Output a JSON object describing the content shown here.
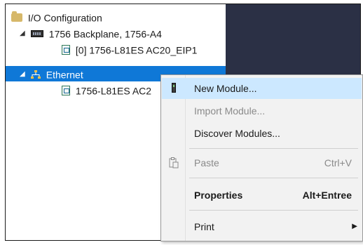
{
  "tree": {
    "root": {
      "label": "I/O Configuration",
      "icon": "folder-icon"
    },
    "backplane": {
      "label": "1756 Backplane, 1756-A4",
      "icon": "backplane-icon",
      "expander": "◢"
    },
    "controller": {
      "label": "[0] 1756-L81ES AC20_EIP1",
      "icon": "module-icon"
    },
    "ethernet": {
      "label": "Ethernet",
      "icon": "ethernet-icon",
      "expander": "◢"
    },
    "eth_module": {
      "label": "1756-L81ES AC2",
      "icon": "module-icon"
    }
  },
  "context_menu": {
    "new_module": {
      "label": "New Module...",
      "icon": "new-module-icon"
    },
    "import_module": {
      "label": "Import Module..."
    },
    "discover_modules": {
      "label": "Discover Modules..."
    },
    "paste": {
      "label": "Paste",
      "shortcut": "Ctrl+V",
      "icon": "paste-icon"
    },
    "properties": {
      "label": "Properties",
      "shortcut": "Alt+Entree"
    },
    "print": {
      "label": "Print",
      "submenu_arrow": "▶"
    }
  },
  "colors": {
    "selection": "#0f78d7",
    "dark_pane": "#2b3045",
    "menu_hover": "#cce8ff",
    "menu_bg": "#f2f2f2"
  }
}
